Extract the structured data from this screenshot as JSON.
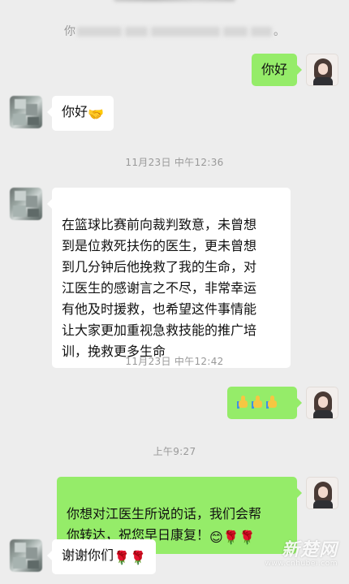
{
  "system_notice": {
    "prefix": "你",
    "suffix": "。"
  },
  "messages": [
    {
      "side": "out",
      "text": "你好"
    },
    {
      "side": "in",
      "text": "你好",
      "emoji": "🤝"
    },
    {
      "time": "11月23日 中午12:36"
    },
    {
      "side": "in",
      "text": "在篮球比赛前向裁判致意，未曾想\n到是位救死扶伤的医生，更未曾想\n到几分钟后他挽救了我的生命，对\n江医生的感谢言之不尽，非常幸运\n有他及时援救，也希望这件事情能\n让大家更加重视急救技能的推广培\n训，挽救更多生命"
    },
    {
      "time": "11月23日 中午12:42"
    },
    {
      "side": "out",
      "emoji": "👍👍👍"
    },
    {
      "time": "上午9:27"
    },
    {
      "side": "out",
      "text": "你想对江医生所说的话，我们会帮\n你转达，祝您早日康复！",
      "emoji": "😊🌹🌹"
    },
    {
      "side": "in",
      "text": "谢谢你们",
      "emoji": "🌹🌹"
    }
  ],
  "watermark": {
    "logo": "新楚网",
    "url": "www.cnhubei.com"
  },
  "colors": {
    "background": "#ededed",
    "bubble_out": "#95ec69",
    "bubble_in": "#ffffff",
    "time_text": "#999999"
  },
  "icons": [
    "handshake-emoji",
    "thumbs-up-emoji",
    "smile-emoji",
    "rose-emoji"
  ]
}
